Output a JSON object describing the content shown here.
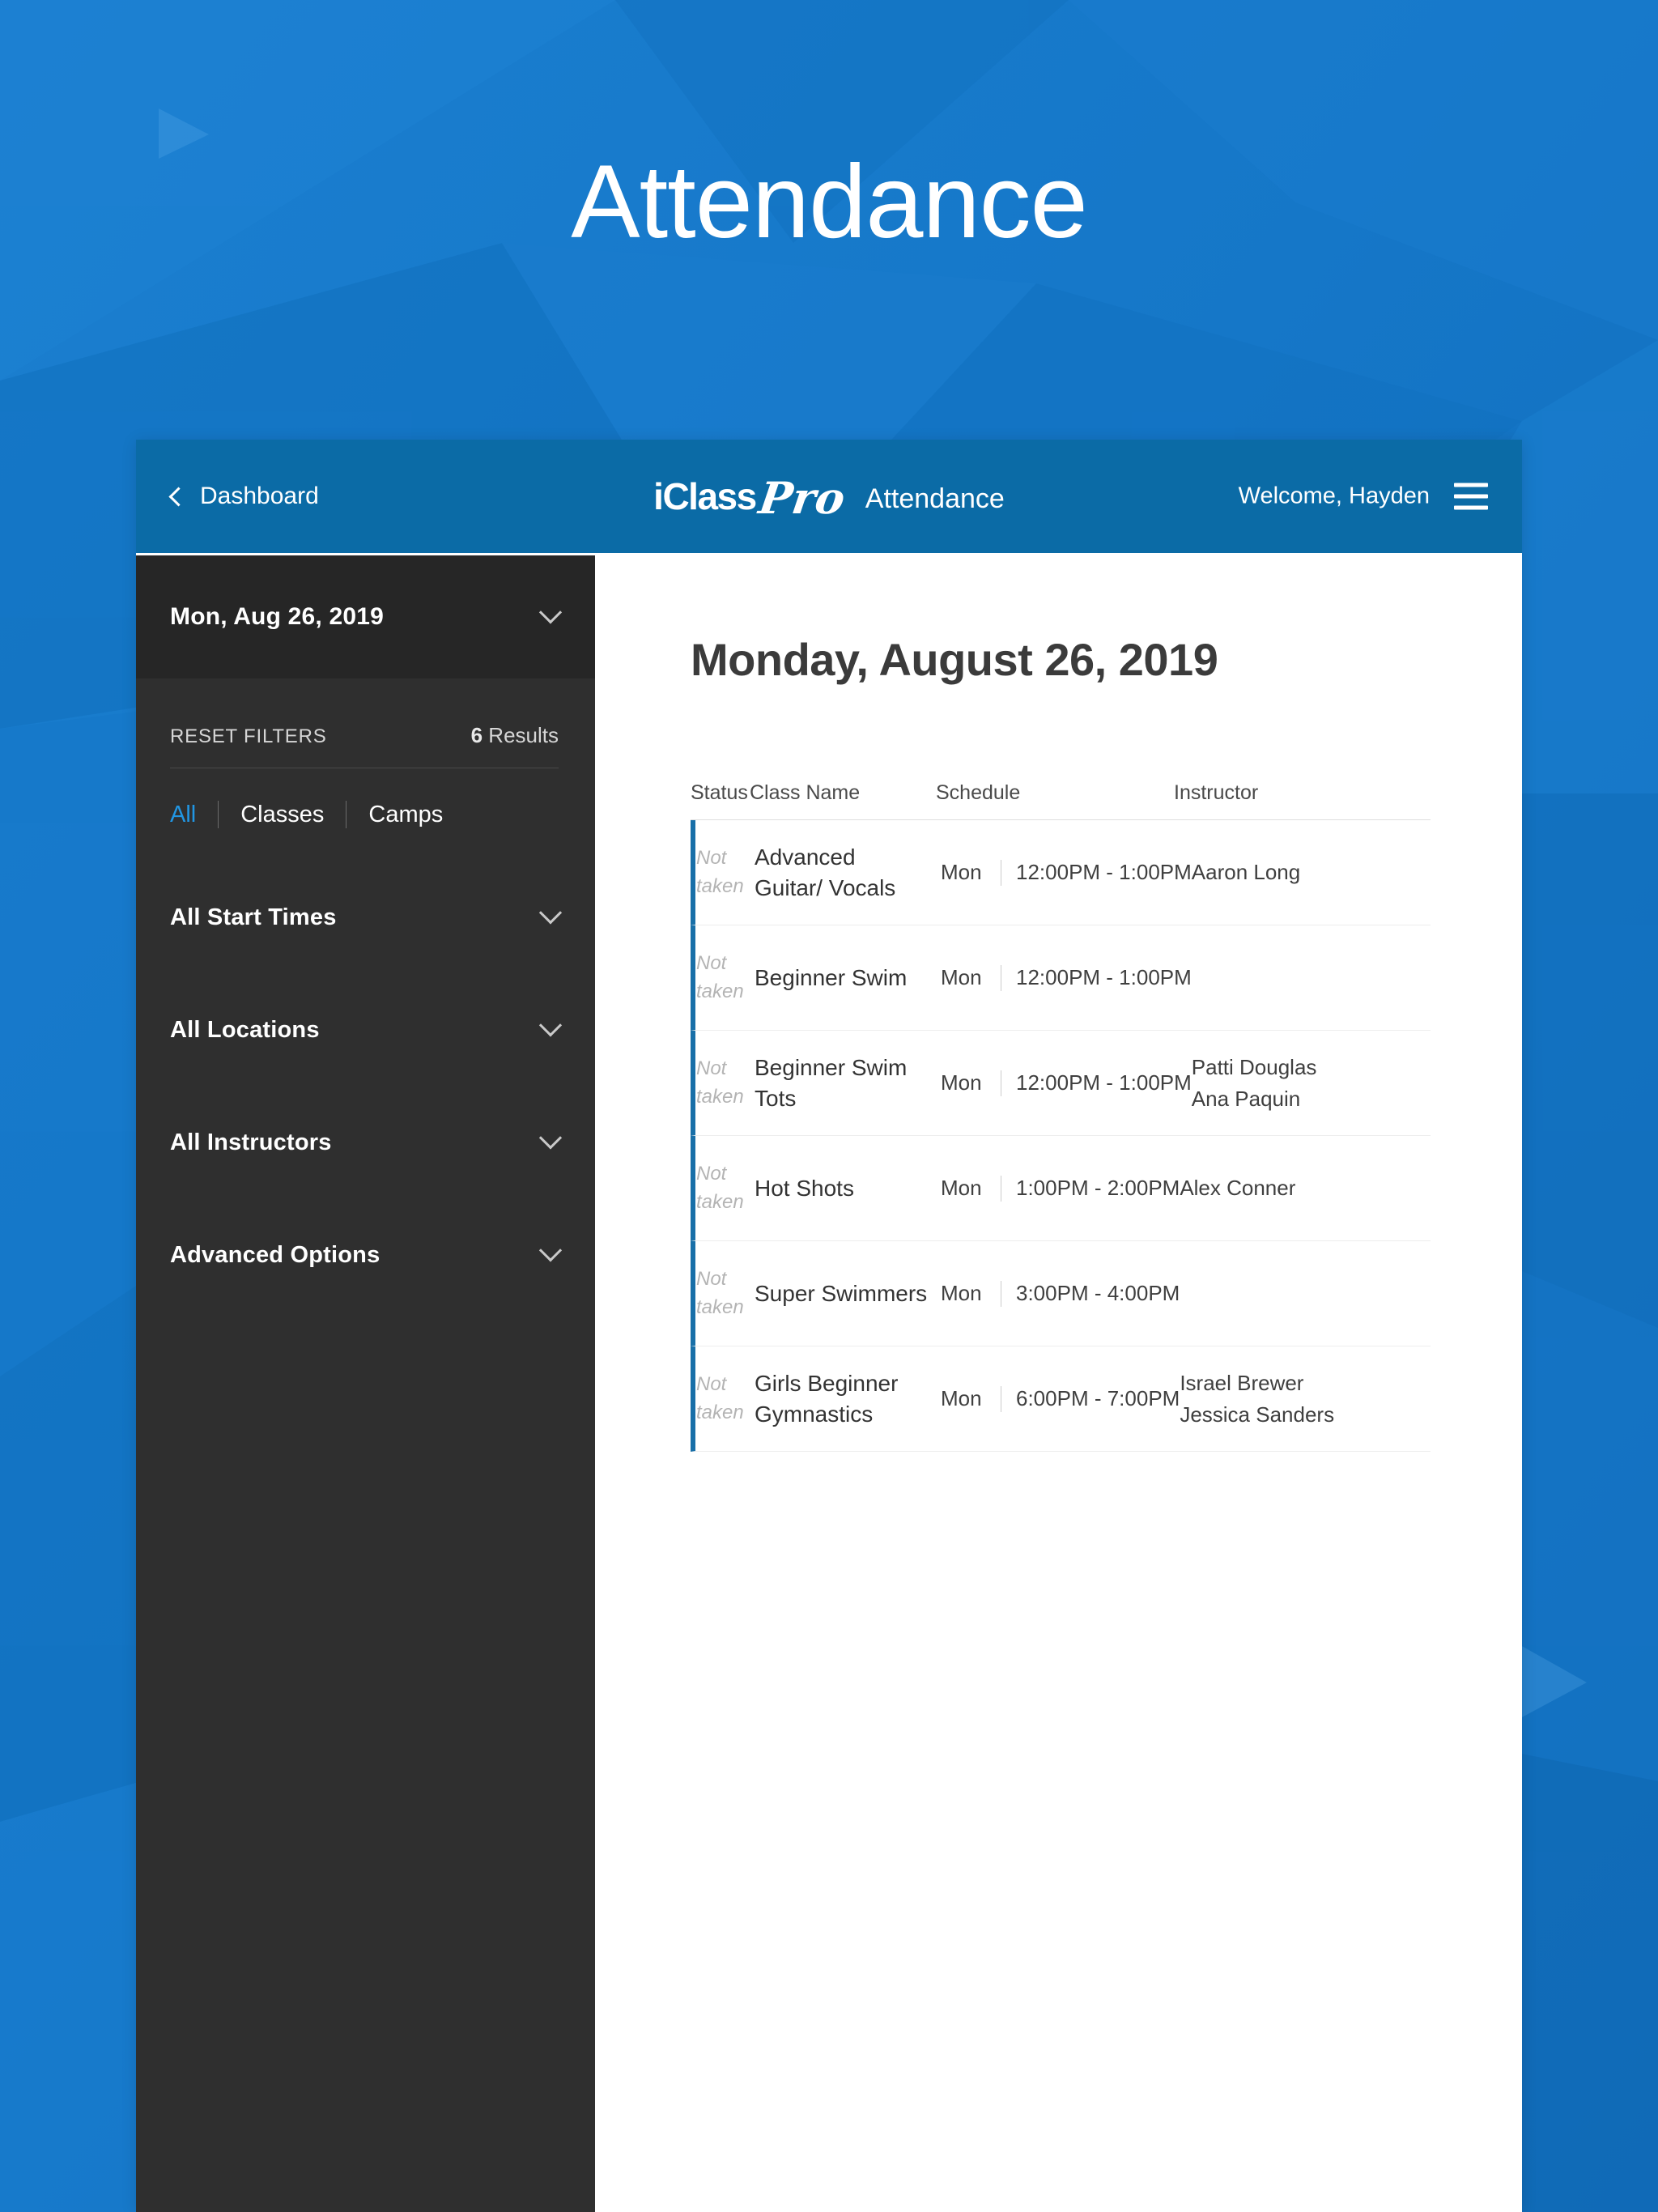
{
  "hero": {
    "title": "Attendance"
  },
  "colors": {
    "page_background": "#1577c8",
    "header_bar": "#0b6ba6",
    "sidebar": "#2f2f2f",
    "sidebar_date": "#262626",
    "accent_blue": "#2196e3",
    "row_accent": "#186fa8"
  },
  "header": {
    "back_label": "Dashboard",
    "back_icon": "chevron-left-icon",
    "logo_primary": "iClass",
    "logo_script": "Pro",
    "app_title": "Attendance",
    "welcome": "Welcome, Hayden",
    "menu_icon": "hamburger-menu-icon"
  },
  "sidebar": {
    "date_value": "Mon, Aug 26, 2019",
    "date_chevron": "chevron-down-icon",
    "reset_filters": "RESET FILTERS",
    "results_count_number": "6",
    "results_count_label": "Results",
    "type_tabs": [
      {
        "label": "All",
        "active": true
      },
      {
        "label": "Classes",
        "active": false
      },
      {
        "label": "Camps",
        "active": false
      }
    ],
    "filter_groups": [
      {
        "label": "All Start Times",
        "icon": "chevron-down-icon"
      },
      {
        "label": "All Locations",
        "icon": "chevron-down-icon"
      },
      {
        "label": "All Instructors",
        "icon": "chevron-down-icon"
      },
      {
        "label": "Advanced Options",
        "icon": "chevron-down-icon"
      }
    ]
  },
  "main": {
    "date_heading": "Monday, August 26, 2019",
    "table": {
      "columns": [
        "Status",
        "Class Name",
        "Schedule",
        "Instructor"
      ],
      "rows": [
        {
          "status": "Not taken",
          "class_name": "Advanced Guitar/ Vocals",
          "day": "Mon",
          "time": "12:00PM - 1:00PM",
          "instructors": [
            "Aaron Long"
          ]
        },
        {
          "status": "Not taken",
          "class_name": "Beginner Swim",
          "day": "Mon",
          "time": "12:00PM - 1:00PM",
          "instructors": []
        },
        {
          "status": "Not taken",
          "class_name": "Beginner Swim Tots",
          "day": "Mon",
          "time": "12:00PM - 1:00PM",
          "instructors": [
            "Patti Douglas",
            "Ana Paquin"
          ]
        },
        {
          "status": "Not taken",
          "class_name": "Hot Shots",
          "day": "Mon",
          "time": "1:00PM - 2:00PM",
          "instructors": [
            "Alex Conner"
          ]
        },
        {
          "status": "Not taken",
          "class_name": "Super Swimmers",
          "day": "Mon",
          "time": "3:00PM - 4:00PM",
          "instructors": []
        },
        {
          "status": "Not taken",
          "class_name": "Girls Beginner Gymnastics",
          "day": "Mon",
          "time": "6:00PM - 7:00PM",
          "instructors": [
            "Israel Brewer",
            "Jessica Sanders"
          ]
        }
      ]
    }
  }
}
